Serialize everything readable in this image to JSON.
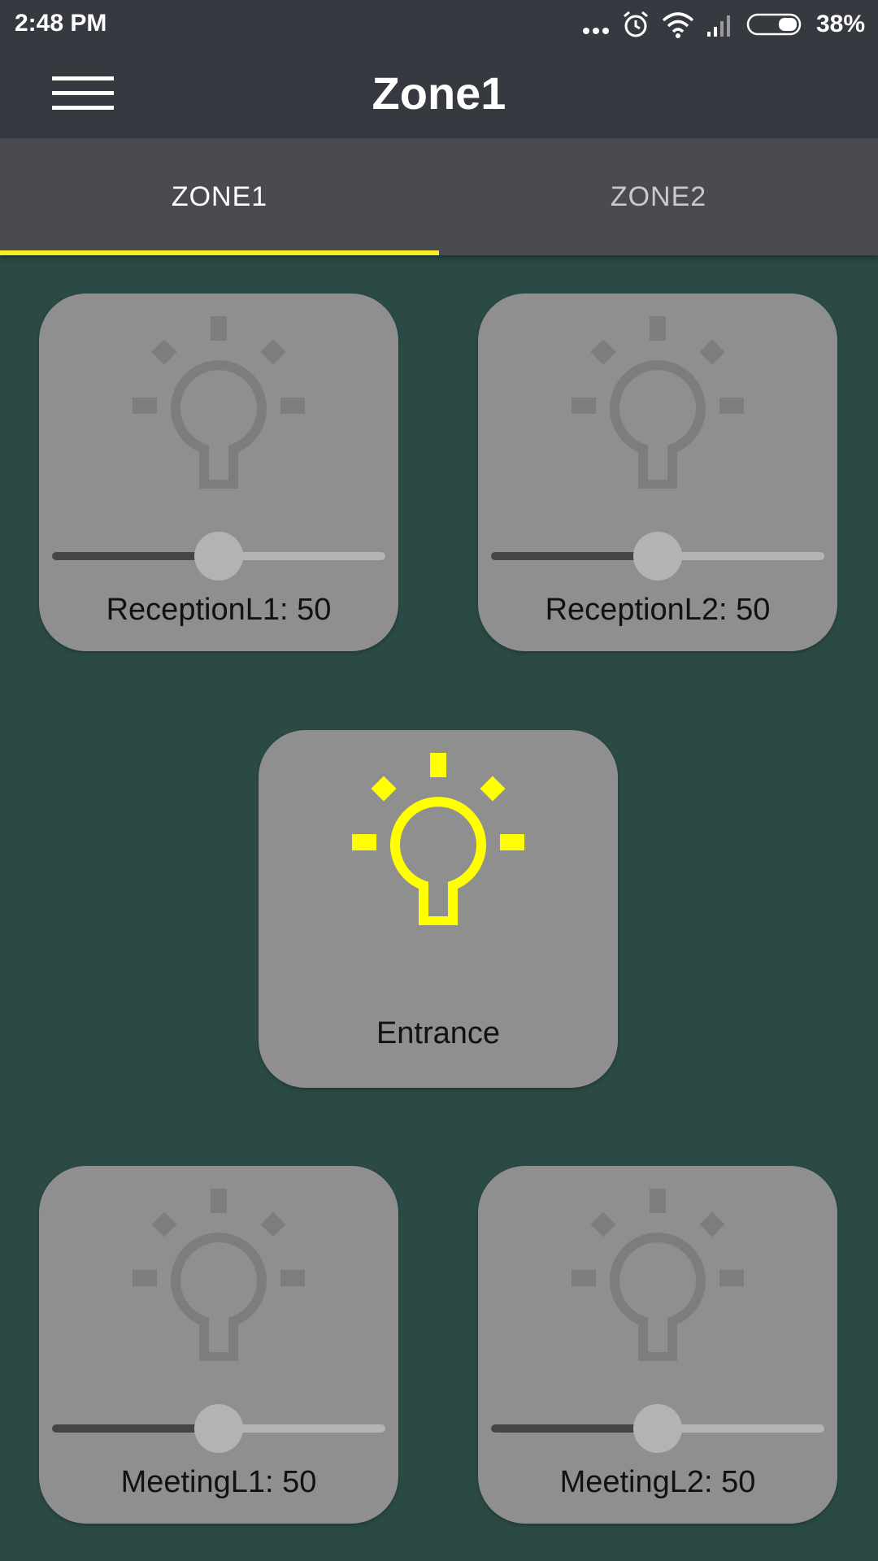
{
  "status_bar": {
    "time": "2:48 PM",
    "battery_percent": "38%",
    "icons": [
      "more-icon",
      "alarm-icon",
      "wifi-icon",
      "signal-icon",
      "battery-icon"
    ]
  },
  "app_bar": {
    "title": "Zone1",
    "menu_icon": "hamburger-menu-icon"
  },
  "tabs": [
    {
      "label": "ZONE1",
      "selected": true
    },
    {
      "label": "ZONE2",
      "selected": false
    }
  ],
  "colors": {
    "background": "#2b4a45",
    "bar": "#363940",
    "tab_bar": "#4a4b50",
    "indicator": "#f7ec22",
    "card": "#8f8f8f",
    "bulb_off": "#7d7d7d",
    "bulb_on": "#ffff00"
  },
  "lights": [
    {
      "name": "ReceptionL1",
      "label": "ReceptionL1: 50",
      "level": 50,
      "on": false,
      "dimmable": true
    },
    {
      "name": "ReceptionL2",
      "label": "ReceptionL2: 50",
      "level": 50,
      "on": false,
      "dimmable": true
    },
    {
      "name": "Entrance",
      "label": "Entrance",
      "on": true,
      "dimmable": false
    },
    {
      "name": "MeetingL1",
      "label": "MeetingL1: 50",
      "level": 50,
      "on": false,
      "dimmable": true
    },
    {
      "name": "MeetingL2",
      "label": "MeetingL2: 50",
      "level": 50,
      "on": false,
      "dimmable": true
    }
  ]
}
